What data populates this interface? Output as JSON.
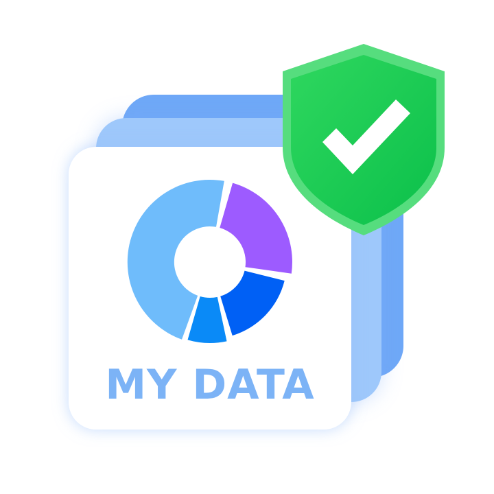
{
  "card": {
    "label": "MY DATA"
  },
  "donut_chart": {
    "segments": [
      {
        "name": "light-blue-segment",
        "color": "#6fbcfb"
      },
      {
        "name": "purple-segment",
        "color": "#9d5bff"
      },
      {
        "name": "blue-segment",
        "color": "#0060f5"
      },
      {
        "name": "mid-blue-segment",
        "color": "#0a8af7"
      }
    ]
  },
  "badge": {
    "icon": "shield-check-icon",
    "shield_color": "#1fcc53",
    "check_color": "#ffffff"
  },
  "colors": {
    "card_back": "#6fa8f7",
    "card_mid": "#9ec8fb",
    "label": "#7cb3f6"
  }
}
